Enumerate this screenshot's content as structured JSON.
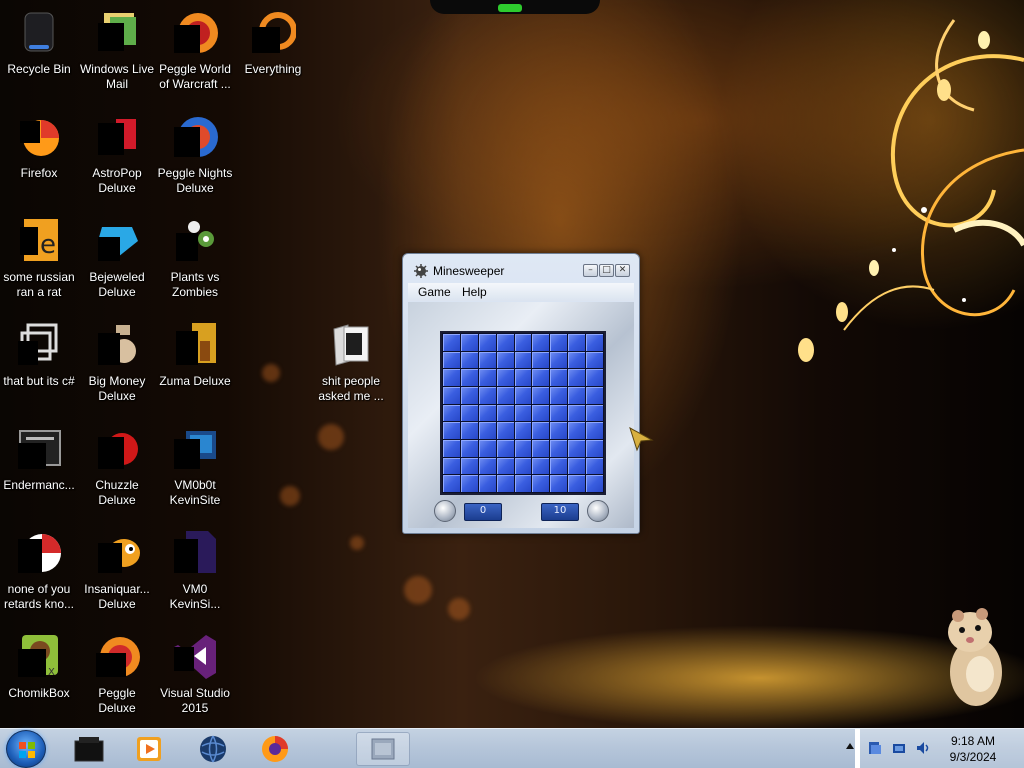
{
  "desktop": {
    "icons": [
      {
        "label": "Recycle Bin",
        "icon": "recycle-bin-icon"
      },
      {
        "label": "Windows Live Mail",
        "icon": "windows-live-mail-icon"
      },
      {
        "label": "Peggle World of Warcraft ...",
        "icon": "peggle-wow-icon"
      },
      {
        "label": "Everything",
        "icon": "everything-search-icon"
      },
      {
        "label": "Firefox",
        "icon": "firefox-icon"
      },
      {
        "label": "AstroPop Deluxe",
        "icon": "astropop-icon"
      },
      {
        "label": "Peggle Nights Deluxe",
        "icon": "peggle-nights-icon"
      },
      {
        "label": "some russian ran a rat",
        "icon": "document-icon"
      },
      {
        "label": "Bejeweled Deluxe",
        "icon": "bejeweled-icon"
      },
      {
        "label": "Plants vs Zombies",
        "icon": "plants-vs-zombies-icon"
      },
      {
        "label": "that but its c#",
        "icon": "shortcut-icon"
      },
      {
        "label": "Big Money Deluxe",
        "icon": "big-money-icon"
      },
      {
        "label": "Zuma Deluxe",
        "icon": "zuma-icon"
      },
      {
        "label": "shit people asked me ...",
        "icon": "folder-icon"
      },
      {
        "label": "Endermanc...",
        "icon": "endermanch-icon"
      },
      {
        "label": "Chuzzle Deluxe",
        "icon": "chuzzle-icon"
      },
      {
        "label": "VM0b0t KevinSite",
        "icon": "vm-shortcut-icon"
      },
      {
        "label": "none of you retards kno...",
        "icon": "document-icon"
      },
      {
        "label": "Insaniquar... Deluxe",
        "icon": "insaniquarium-icon"
      },
      {
        "label": "VM0 KevinSi...",
        "icon": "file-icon"
      },
      {
        "label": "ChomikBox",
        "icon": "chomikbox-icon"
      },
      {
        "label": "Peggle Deluxe",
        "icon": "peggle-icon"
      },
      {
        "label": "Visual Studio 2015",
        "icon": "visual-studio-icon"
      }
    ]
  },
  "window": {
    "title": "Minesweeper",
    "menu": [
      "Game",
      "Help"
    ],
    "timer": "0",
    "mines_left": "10",
    "grid": {
      "rows": 9,
      "cols": 9
    }
  },
  "taskbar": {
    "pinned": [
      "explorer-icon",
      "media-player-icon",
      "globe-icon",
      "firefox-icon",
      "minesweeper-taskbar-icon"
    ],
    "clock_time": "9:18 AM",
    "clock_date": "9/3/2024"
  },
  "colors": {
    "accent": "#2747c8",
    "taskbar": "#b6c6da"
  }
}
